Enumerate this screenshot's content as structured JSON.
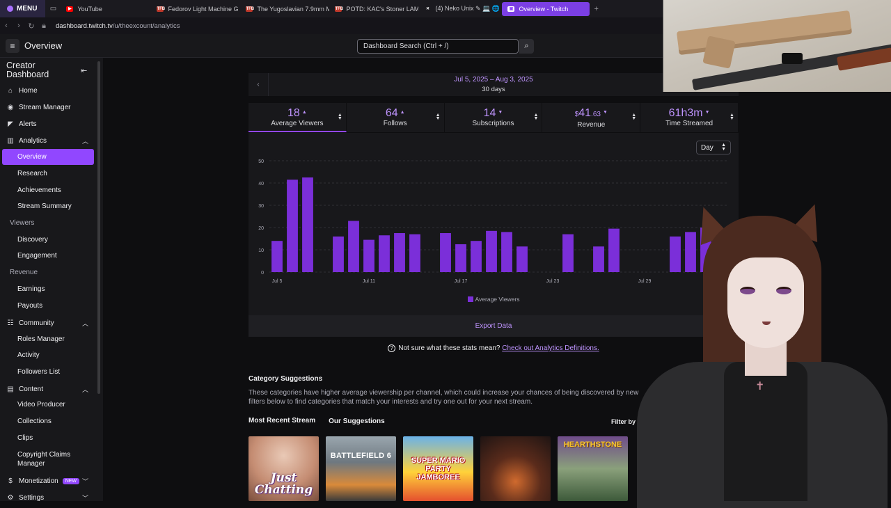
{
  "browser": {
    "menu_label": "MENU",
    "tabs": [
      {
        "label": "YouTube",
        "color": "#ff0000",
        "fav": "▶"
      },
      {
        "label": "Fedorov Light Machine G",
        "color": "#c0392b",
        "fav": "TFB"
      },
      {
        "label": "The Yugoslavian 7.9mm M",
        "color": "#c0392b",
        "fav": "TFB"
      },
      {
        "label": "POTD: KAC's Stoner LAM",
        "color": "#c0392b",
        "fav": "TFB"
      },
      {
        "label": "(4) Neko Unix ✎ 💻 🌐",
        "color": "#1b1a1f",
        "fav": "X"
      },
      {
        "label": "Overview - Twitch",
        "color": "#9147ff",
        "fav": "▣"
      }
    ],
    "url_domain": "dashboard.twitch.tv",
    "url_path": "/u/theexcount/analytics"
  },
  "topnav": {
    "page_title": "Overview",
    "search_value": "Dashboard Search (Ctrl + /)"
  },
  "sidebar": {
    "title_line1": "Creator",
    "title_line2": "Dashboard",
    "home": "Home",
    "stream_manager": "Stream Manager",
    "alerts": "Alerts",
    "analytics": "Analytics",
    "overview": "Overview",
    "research": "Research",
    "achievements": "Achievements",
    "stream_summary": "Stream Summary",
    "viewers_group": "Viewers",
    "discovery": "Discovery",
    "engagement": "Engagement",
    "revenue_group": "Revenue",
    "earnings": "Earnings",
    "payouts": "Payouts",
    "community": "Community",
    "roles_manager": "Roles Manager",
    "activity": "Activity",
    "followers_list": "Followers List",
    "content": "Content",
    "video_producer": "Video Producer",
    "collections": "Collections",
    "clips": "Clips",
    "copyright_1": "Copyright Claims",
    "copyright_2": "Manager",
    "monetization": "Monetization",
    "new_badge": "NEW",
    "settings": "Settings"
  },
  "date": {
    "range": "Jul 5, 2025 – Aug 3, 2025",
    "days": "30 days"
  },
  "stats": [
    {
      "value": "18",
      "label": "Average Viewers",
      "trend": "up"
    },
    {
      "value": "64",
      "label": "Follows",
      "trend": "up"
    },
    {
      "value": "14",
      "label": "Subscriptions",
      "trend": "down"
    },
    {
      "value_prefix": "$",
      "value": "41",
      "value_cents": ".63",
      "label": "Revenue",
      "trend": "down"
    },
    {
      "value": "61h3m",
      "label": "Time Streamed",
      "trend": "down"
    }
  ],
  "chart": {
    "granularity": "Day",
    "export_label": "Export Data",
    "legend": "Average Viewers"
  },
  "chart_data": {
    "type": "bar",
    "categories": [
      "Jul 5",
      "Jul 6",
      "Jul 7",
      "Jul 8",
      "Jul 9",
      "Jul 10",
      "Jul 11",
      "Jul 12",
      "Jul 13",
      "Jul 14",
      "Jul 15",
      "Jul 16",
      "Jul 17",
      "Jul 18",
      "Jul 19",
      "Jul 20",
      "Jul 21",
      "Jul 22",
      "Jul 23",
      "Jul 24",
      "Jul 25",
      "Jul 26",
      "Jul 27",
      "Jul 28",
      "Jul 29",
      "Jul 30",
      "Jul 31",
      "Aug 1",
      "Aug 2",
      "Aug 3"
    ],
    "tick_labels": [
      "Jul 5",
      "Jul 11",
      "Jul 17",
      "Jul 23",
      "Jul 29"
    ],
    "series": [
      {
        "name": "Average Viewers",
        "color": "#7b2fd9",
        "values": [
          14,
          41.5,
          42.5,
          0,
          16,
          23,
          14.5,
          16.5,
          17.5,
          17,
          0,
          17.5,
          12.5,
          14,
          18.5,
          18,
          11.5,
          0,
          0,
          17,
          0,
          11.5,
          19.5,
          0,
          0,
          0,
          16,
          18,
          20,
          0
        ]
      }
    ],
    "ylim": [
      0,
      50
    ],
    "yticks": [
      0,
      10,
      20,
      30,
      40,
      50
    ],
    "grid": true,
    "legend_position": "bottom"
  },
  "help": {
    "text": "Not sure what these stats mean?",
    "link": "Check out Analytics Definitions."
  },
  "categories": {
    "title": "Category Suggestions",
    "desc": "These categories have higher average viewership per channel, which could increase your chances of being discovered by new filters below to find categories that match your interests and try one out for your next stream.",
    "tab_recent": "Most Recent Stream",
    "tab_ours": "Our Suggestions",
    "filter": "Filter by",
    "tiles": [
      "Just Chatting",
      "BATTLEFIELD 6",
      "SUPER MARIO PARTY JAMBOREE",
      "",
      "HEARTHSTONE"
    ]
  }
}
